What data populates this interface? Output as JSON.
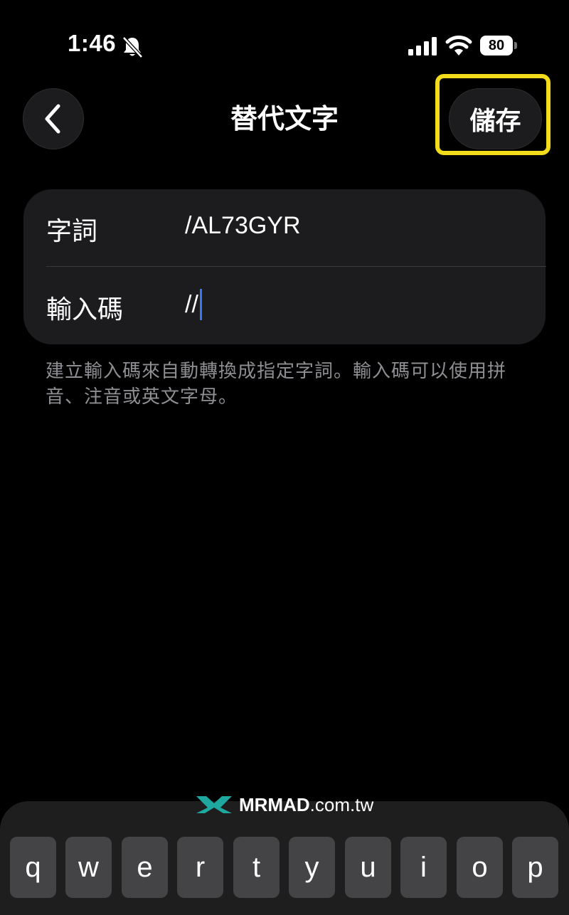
{
  "status_bar": {
    "time": "1:46",
    "battery": "80",
    "icons": [
      "bell-slash-icon",
      "cellular-signal-icon",
      "wifi-icon",
      "battery-icon"
    ]
  },
  "nav": {
    "title": "替代文字",
    "save_label": "儲存",
    "back_icon": "chevron-left-icon",
    "highlight_color": "#f3dc1c"
  },
  "form": {
    "phrase_label": "字詞",
    "phrase_value": "/AL73GYR",
    "shortcut_label": "輸入碼",
    "shortcut_value": "//"
  },
  "helper_text": "建立輸入碼來自動轉換成指定字詞。輸入碼可以使用拼音、注音或英文字母。",
  "watermark": {
    "brand": "MRMAD",
    "domain": ".com.tw"
  },
  "keyboard": {
    "row1": [
      "q",
      "w",
      "e",
      "r",
      "t",
      "y",
      "u",
      "i",
      "o",
      "p"
    ]
  },
  "colors": {
    "background": "#000000",
    "card": "#1c1c1e",
    "caret": "#3478f6",
    "helper": "#8e8e93"
  }
}
